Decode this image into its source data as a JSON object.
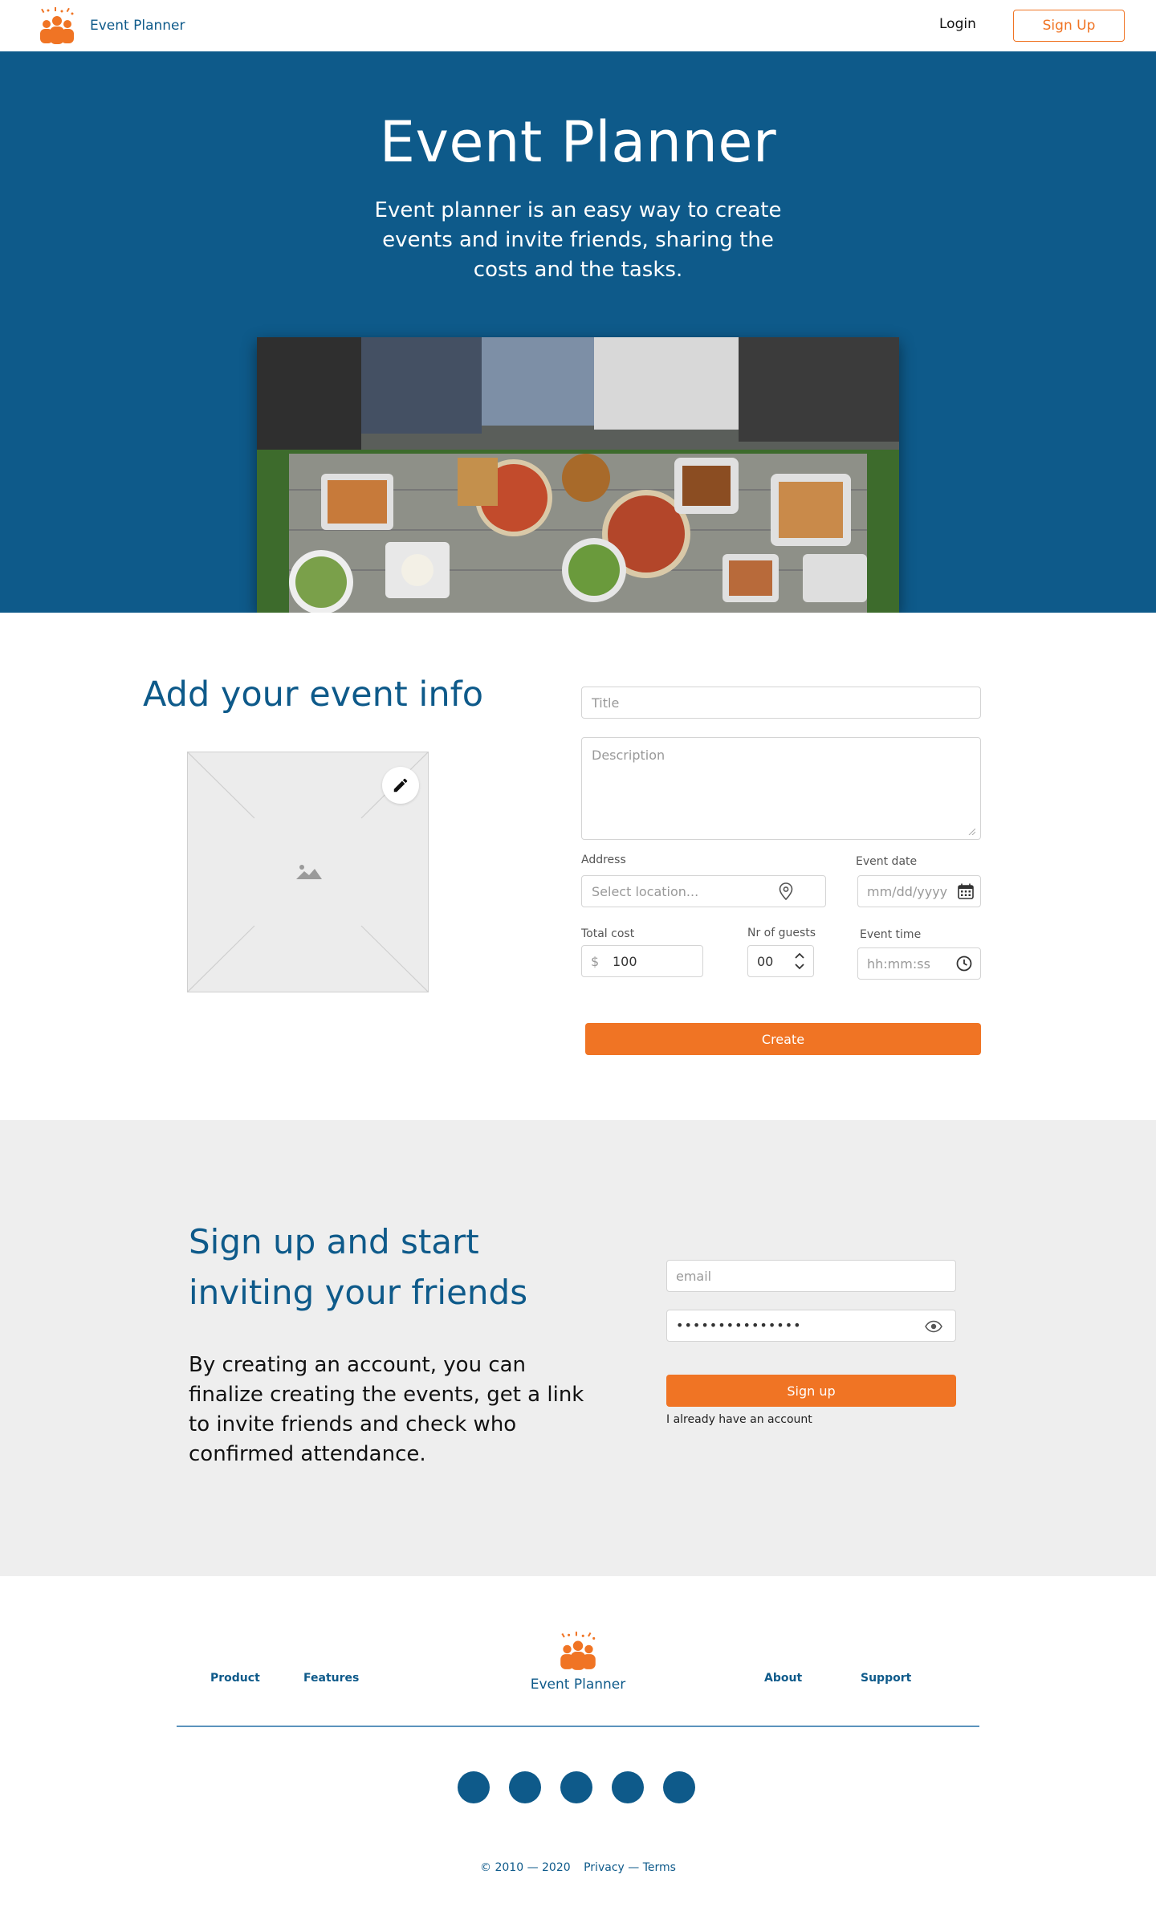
{
  "header": {
    "brand_name": "Event Planner",
    "login_label": "Login",
    "signup_label": "Sign Up"
  },
  "hero": {
    "title": "Event Planner",
    "text": "Event planner is an easy way to create events and invite friends, sharing the costs and the tasks."
  },
  "event_form": {
    "heading": "Add your event info",
    "title_placeholder": "Title",
    "description_placeholder": "Description",
    "address_label": "Address",
    "address_placeholder": "Select location...",
    "event_date_label": "Event date",
    "event_date_placeholder": "mm/dd/yyyy",
    "total_cost_label": "Total cost",
    "currency_symbol": "$",
    "total_cost_value": "100",
    "guests_label": "Nr of guests",
    "guests_value": "00",
    "event_time_label": "Event time",
    "event_time_placeholder": "hh:mm:ss",
    "create_label": "Create"
  },
  "signup": {
    "heading": "Sign up and start inviting your friends",
    "text": "By creating an account, you can finalize creating the events, get a link to invite friends and check who confirmed attendance.",
    "email_placeholder": "email",
    "password_value": "•••••••••••••••",
    "button_label": "Sign up",
    "have_account_label": "I already have an account"
  },
  "footer": {
    "links_left": [
      "Product",
      "Features"
    ],
    "brand_name": "Event Planner",
    "links_right": [
      "About",
      "Support"
    ],
    "social_count": 5,
    "copyright": "© 2010 — 2020",
    "legal": "Privacy — Terms"
  },
  "colors": {
    "primary": "#0e5a8a",
    "accent": "#f07424",
    "section_bg": "#eeeeee"
  },
  "icons": [
    "logo-icon",
    "edit-pencil-icon",
    "image-icon",
    "location-pin-icon",
    "calendar-icon",
    "stepper-icon",
    "clock-icon",
    "eye-icon",
    "social-icon"
  ]
}
